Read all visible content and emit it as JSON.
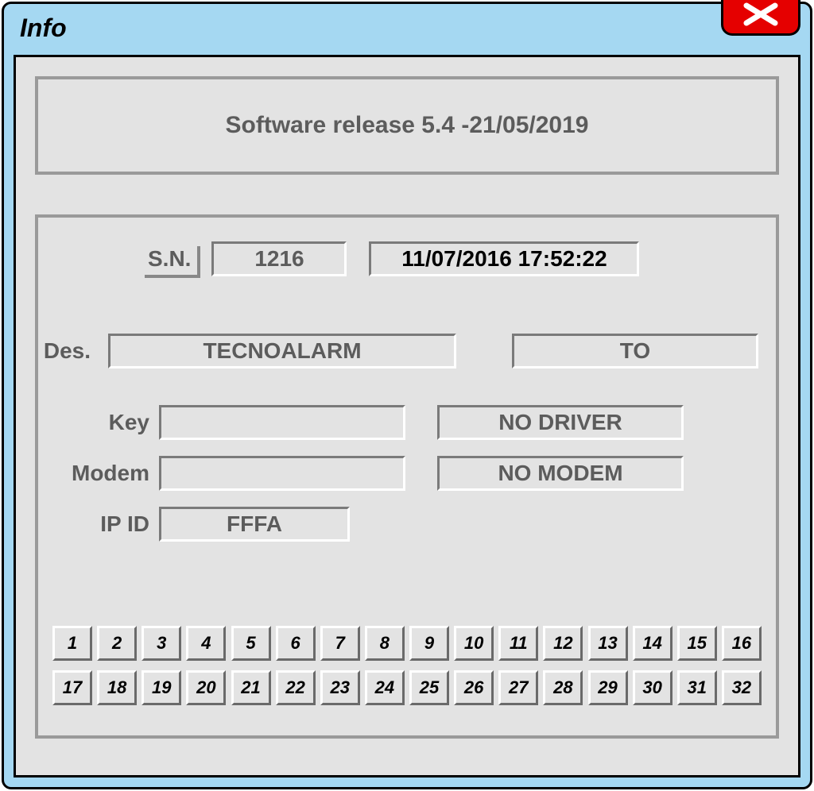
{
  "window": {
    "title": "Info"
  },
  "release": {
    "text": "Software release 5.4 -21/05/2019"
  },
  "sn": {
    "label": "S.N.",
    "value": "1216",
    "datetime": "11/07/2016 17:52:22"
  },
  "des": {
    "label": "Des.",
    "value": "TECNOALARM",
    "to": "TO"
  },
  "key": {
    "label": "Key",
    "value": "",
    "status": "NO DRIVER"
  },
  "modem": {
    "label": "Modem",
    "value": "",
    "status": "NO MODEM"
  },
  "ipid": {
    "label": "IP ID",
    "value": "FFFA"
  },
  "buttons": {
    "row1": [
      "1",
      "2",
      "3",
      "4",
      "5",
      "6",
      "7",
      "8",
      "9",
      "10",
      "11",
      "12",
      "13",
      "14",
      "15",
      "16"
    ],
    "row2": [
      "17",
      "18",
      "19",
      "20",
      "21",
      "22",
      "23",
      "24",
      "25",
      "26",
      "27",
      "28",
      "29",
      "30",
      "31",
      "32"
    ]
  }
}
